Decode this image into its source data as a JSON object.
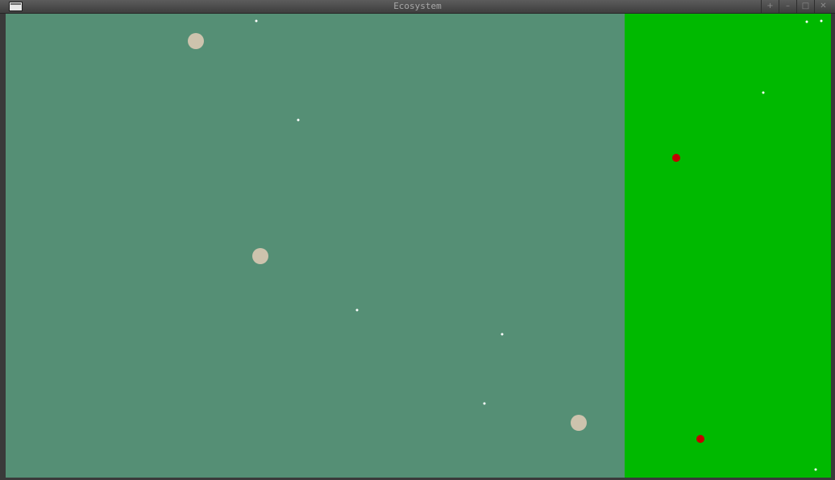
{
  "window": {
    "title": "Ecosystem",
    "controls": [
      {
        "name": "pin-button",
        "icon": "pin-icon",
        "glyph": "+"
      },
      {
        "name": "minimize-button",
        "icon": "minimize-icon",
        "glyph": "–"
      },
      {
        "name": "maximize-button",
        "icon": "maximize-icon",
        "glyph": "□"
      },
      {
        "name": "close-button",
        "icon": "close-icon",
        "glyph": "✕"
      }
    ]
  },
  "terrain": {
    "water": {
      "color": "#558f75"
    },
    "grass": {
      "color": "#00b900"
    }
  },
  "colors": {
    "sand_blob": "#cdc3ad",
    "white_particle": "#ffffff",
    "red_creature": "#c40000"
  }
}
